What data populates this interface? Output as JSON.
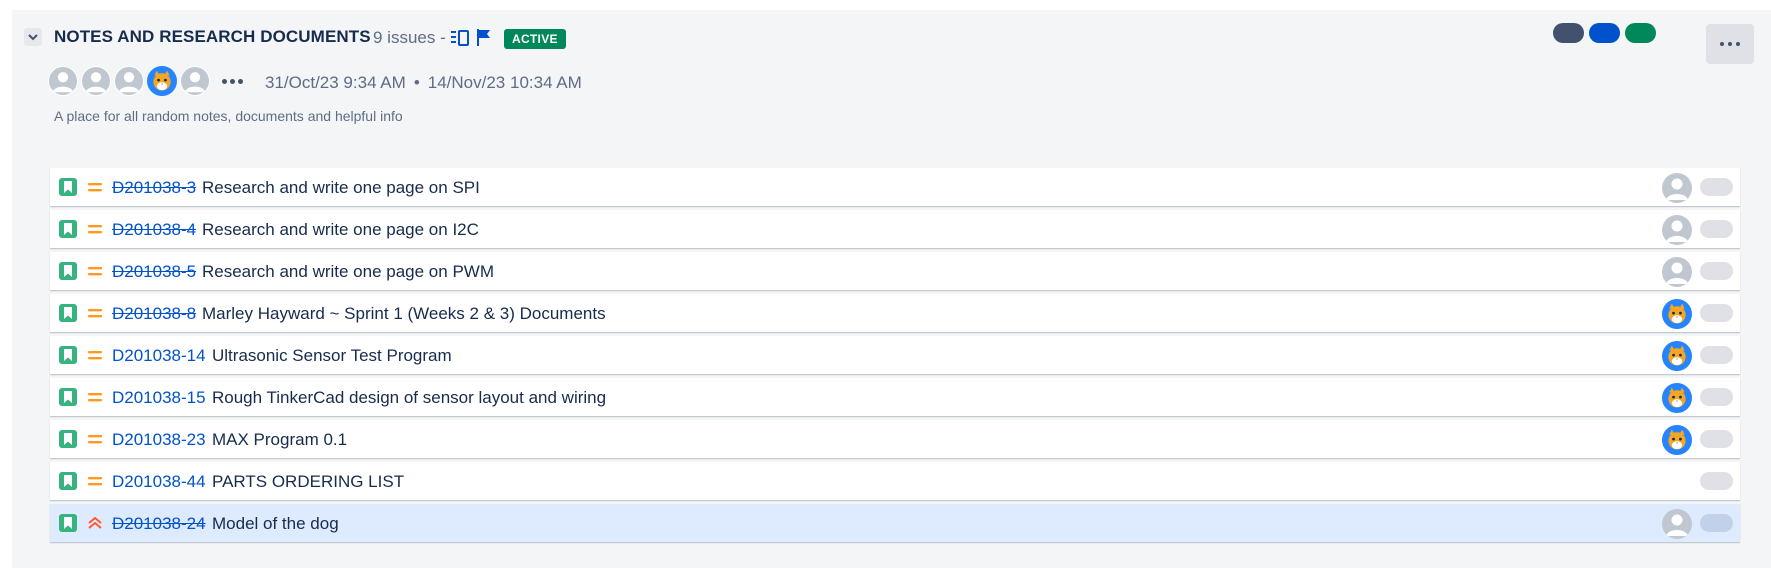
{
  "header": {
    "title": "NOTES AND RESEARCH DOCUMENTS",
    "issue_count": "9 issues -",
    "status_badge": "ACTIVE",
    "start_date": "31/Oct/23 9:34 AM",
    "date_separator": "•",
    "end_date": "14/Nov/23 10:34 AM",
    "description": "A place for all random notes, documents and helpful info",
    "colors": [
      "#42526e",
      "#0052cc",
      "#00875a"
    ]
  },
  "participants": [
    {
      "avatar": "default-avatar-icon"
    },
    {
      "avatar": "default-avatar-icon"
    },
    {
      "avatar": "default-avatar-icon"
    },
    {
      "avatar": "cat-avatar-icon"
    },
    {
      "avatar": "default-avatar-icon"
    }
  ],
  "issues": [
    {
      "key": "D201038-3",
      "summary": "Research and write one page on SPI",
      "done": true,
      "priority": "medium",
      "assignee": "default",
      "selected": false
    },
    {
      "key": "D201038-4",
      "summary": "Research and write one page on I2C",
      "done": true,
      "priority": "medium",
      "assignee": "default",
      "selected": false
    },
    {
      "key": "D201038-5",
      "summary": "Research and write one page on PWM",
      "done": true,
      "priority": "medium",
      "assignee": "default",
      "selected": false
    },
    {
      "key": "D201038-8",
      "summary": "Marley Hayward ~ Sprint 1 (Weeks 2 & 3) Documents",
      "done": true,
      "priority": "medium",
      "assignee": "cat",
      "selected": false
    },
    {
      "key": "D201038-14",
      "summary": "Ultrasonic Sensor Test Program",
      "done": false,
      "priority": "medium",
      "assignee": "cat",
      "selected": false
    },
    {
      "key": "D201038-15",
      "summary": "Rough TinkerCad design of sensor layout and wiring",
      "done": false,
      "priority": "medium",
      "assignee": "cat",
      "selected": false
    },
    {
      "key": "D201038-23",
      "summary": "MAX Program 0.1",
      "done": false,
      "priority": "medium",
      "assignee": "cat",
      "selected": false
    },
    {
      "key": "D201038-44",
      "summary": "PARTS ORDERING LIST",
      "done": false,
      "priority": "medium",
      "assignee": "none",
      "selected": false
    },
    {
      "key": "D201038-24",
      "summary": "Model of the dog",
      "done": true,
      "priority": "highest",
      "assignee": "default",
      "selected": true
    }
  ]
}
